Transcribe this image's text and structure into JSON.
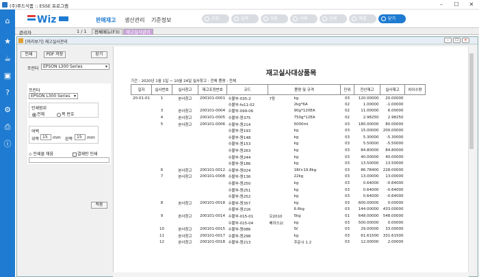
{
  "window": {
    "title": "(주)푸드식품 :: ESSE 프로그램"
  },
  "menus": [
    "판매재고",
    "생산관리",
    "기준정보"
  ],
  "toolbar": [
    "조회",
    "입력",
    "저장",
    "삭제",
    "인쇄",
    "엑셀",
    "닫기"
  ],
  "user": "관리자",
  "page": "1 / 1",
  "tabs": [
    "전체메뉴(F3)",
    "재고실사관리"
  ],
  "dialog": {
    "title": "[미리보기] 재고실사관리"
  },
  "left": {
    "print_btn": "인쇄",
    "pdf_btn": "PDF 저장",
    "close_btn": "닫기",
    "printer_label": "프린터",
    "printer_value": "EPSON L300 Series",
    "printer2_label": "프린터",
    "printer2_value": "EPSON L300 Series",
    "range_label": "인쇄범위",
    "range_all": "전체",
    "range_page": "쪽 번호",
    "margin_label": "여백",
    "top_label": "위쪽",
    "top_value": "15",
    "left_label": "왼쪽",
    "left_value": "15",
    "unit": "mm",
    "fit_label": "인쇄물 채움",
    "grid_label": "결재란 인쇄",
    "apply_btn": "적용"
  },
  "report": {
    "title": "재고실사대상품목",
    "info": "기간 : 2020년 1월 1일 ~ 10월 24일   실사창고 : 전체   품명 : 전체",
    "headers": [
      "일자",
      "실사번호",
      "실사창고",
      "재고조정번호",
      "코드",
      "품명 및 규격",
      "단위",
      "전산재고",
      "실사재고",
      "차이수량"
    ],
    "rows": [
      [
        "20-01-01",
        "1",
        "본사창고",
        "200101-0001",
        "수불부-035-2",
        "7장",
        "kg",
        "03",
        "120.00000",
        "20.00000"
      ],
      [
        "",
        "",
        "",
        "",
        "수불부-fo11-02",
        "",
        "2kg*6A",
        "02",
        "1.00000",
        "-1.00000"
      ],
      [
        "",
        "3",
        "본사창고",
        "200101-0004",
        "수불부-099-06",
        "",
        "90g*120EA",
        "02",
        "11.00000",
        "6.00000"
      ],
      [
        "",
        "4",
        "본사창고",
        "200101-0005",
        "수불부-원375",
        "",
        "750g*12EA",
        "02",
        "2.98250",
        "2.98250"
      ],
      [
        "",
        "5",
        "본사창고",
        "200101-0006",
        "수불부-원214",
        "",
        "5000ml",
        "03",
        "180.00000",
        "80.00000"
      ],
      [
        "",
        "",
        "",
        "",
        "수불부-원193",
        "",
        "kg",
        "03",
        "15.00000",
        "200.00000"
      ],
      [
        "",
        "",
        "",
        "",
        "수불부-원148",
        "",
        "kg",
        "03",
        "5.30000",
        "-5.30000"
      ],
      [
        "",
        "",
        "",
        "",
        "수불부-원153",
        "",
        "kg",
        "03",
        "5.50000",
        "-5.50000"
      ],
      [
        "",
        "",
        "",
        "",
        "수불부-원263",
        "",
        "kg",
        "03",
        "84.80000",
        "84.80000"
      ],
      [
        "",
        "",
        "",
        "",
        "수불부-원244",
        "",
        "kg",
        "03",
        "40.00000",
        "40.00000"
      ],
      [
        "",
        "",
        "",
        "",
        "수불부-원186",
        "",
        "kg",
        "03",
        "13.50000",
        "13.50000"
      ],
      [
        "",
        "6",
        "본사창고",
        "200101-0012",
        "수불부-원024",
        "",
        "18ℓ×19.8kg",
        "03",
        "86.78400",
        "228.00000"
      ],
      [
        "",
        "7",
        "본사창고",
        "200101-0008",
        "수불부-원136",
        "",
        "22kg",
        "03",
        "13.00000",
        "13.00000"
      ],
      [
        "",
        "",
        "",
        "",
        "수불부-원250",
        "",
        "kg",
        "03",
        "0.64000",
        "-0.64000"
      ],
      [
        "",
        "",
        "",
        "",
        "수불부-원251",
        "",
        "kg",
        "03",
        "0.64000",
        "-0.64000"
      ],
      [
        "",
        "",
        "",
        "",
        "수불부-원252",
        "",
        "kg",
        "03",
        "0.64000",
        "-0.64000"
      ],
      [
        "",
        "8",
        "본사창고",
        "200101-0018",
        "수불부-원357",
        "",
        "kg",
        "03",
        "600.00000",
        "0.00000"
      ],
      [
        "",
        "",
        "",
        "",
        "수불부-원216",
        "",
        "6.6kg",
        "03",
        "144.00000",
        "433.00000"
      ],
      [
        "",
        "9",
        "본사창고",
        "200101-0014",
        "수불부-015-01",
        "오2010",
        "5kg",
        "01",
        "648.00000",
        "548.00000"
      ],
      [
        "",
        "",
        "",
        "",
        "수불부-015-04",
        "베이스2(",
        "kg",
        "03",
        "500.00000",
        "0.00000"
      ],
      [
        "",
        "10",
        "본사창고",
        "200101-0015",
        "수불부-원086",
        "",
        "5ℓ",
        "03",
        "29.00000",
        "33.00000"
      ],
      [
        "",
        "11",
        "본사창고",
        "200101-0017",
        "수불부-원298",
        "",
        "kg",
        "03",
        "61.61500",
        "331.61500"
      ],
      [
        "",
        "12",
        "본사창고",
        "200101-0018",
        "수불부-원213",
        "",
        "주문시 1.2",
        "03",
        "12.00000",
        "2.00000"
      ]
    ]
  }
}
